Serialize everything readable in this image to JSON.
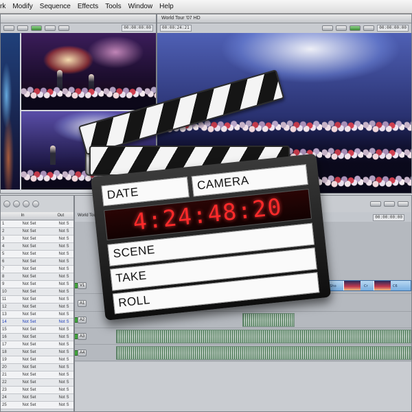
{
  "menubar": {
    "items": [
      "rk",
      "Modify",
      "Sequence",
      "Effects",
      "Tools",
      "Window",
      "Help"
    ]
  },
  "viewer": {
    "timecode": "00:00:00:00"
  },
  "canvas": {
    "title": "World Tour '07 HD",
    "timecode_left": "00:00:24:21",
    "timecode_right": "00:00:00:00"
  },
  "browser": {
    "columns": [
      "",
      "In",
      "Out"
    ],
    "rows": [
      {
        "num": "1",
        "in": "Not Set",
        "out": "Not S"
      },
      {
        "num": "2",
        "in": "Not Set",
        "out": "Not S"
      },
      {
        "num": "3",
        "in": "Not Set",
        "out": "Not S"
      },
      {
        "num": "4",
        "in": "Not Set",
        "out": "Not S"
      },
      {
        "num": "5",
        "in": "Not Set",
        "out": "Not S"
      },
      {
        "num": "6",
        "in": "Not Set",
        "out": "Not S"
      },
      {
        "num": "7",
        "in": "Not Set",
        "out": "Not S"
      },
      {
        "num": "8",
        "in": "Not Set",
        "out": "Not S"
      },
      {
        "num": "9",
        "in": "Not Set",
        "out": "Not S"
      },
      {
        "num": "10",
        "in": "Not Set",
        "out": "Not S"
      },
      {
        "num": "11",
        "in": "Not Set",
        "out": "Not S"
      },
      {
        "num": "12",
        "in": "Not Set",
        "out": "Not S"
      },
      {
        "num": "13",
        "in": "Not Set",
        "out": "Not S"
      },
      {
        "num": "14",
        "in": "Not Set",
        "out": "Not S"
      },
      {
        "num": "15",
        "in": "Not Set",
        "out": "Not S"
      },
      {
        "num": "16",
        "in": "Not Set",
        "out": "Not S"
      },
      {
        "num": "17",
        "in": "Not Set",
        "out": "Not S"
      },
      {
        "num": "18",
        "in": "Not Set",
        "out": "Not S"
      },
      {
        "num": "19",
        "in": "Not Set",
        "out": "Not S"
      },
      {
        "num": "20",
        "in": "Not Set",
        "out": "Not S"
      },
      {
        "num": "21",
        "in": "Not Set",
        "out": "Not S"
      },
      {
        "num": "22",
        "in": "Not Set",
        "out": "Not S"
      },
      {
        "num": "23",
        "in": "Not Set",
        "out": "Not S"
      },
      {
        "num": "24",
        "in": "Not Set",
        "out": "Not S"
      },
      {
        "num": "25",
        "in": "Not Set",
        "out": "Not S"
      }
    ]
  },
  "timeline": {
    "sequence_tab": "World Tour",
    "timecode": "00:00:00:00",
    "tracks": [
      "V1",
      "A1",
      "A2",
      "A3",
      "A4"
    ],
    "clip_label": "Crowd_Sho",
    "clip_label_2": "Cr",
    "clip_label_3": "C6"
  },
  "slate": {
    "date_label": "DATE",
    "camera_label": "CAMERA",
    "timecode": "4:24:48:20",
    "scene_label": "SCENE",
    "take_label": "TAKE",
    "roll_label": "ROLL"
  },
  "colors": {
    "timecode_red": "#ff2a2a",
    "audio_green": "#9fb7a7",
    "video_clip_blue": "#79aee0"
  }
}
